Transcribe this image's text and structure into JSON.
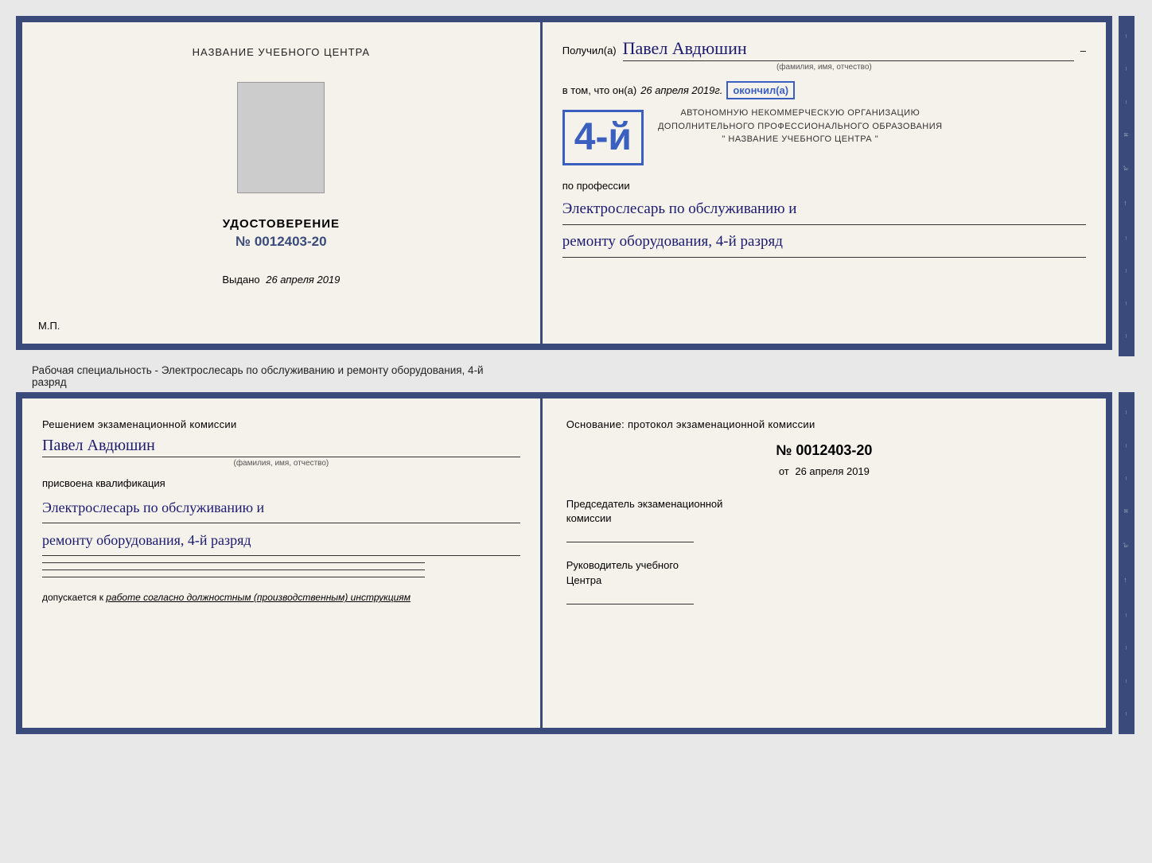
{
  "top_left": {
    "center_title": "НАЗВАНИЕ УЧЕБНОГО ЦЕНТРА",
    "udostoverenie_title": "УДОСТОВЕРЕНИЕ",
    "number": "№ 0012403-20",
    "vydano_label": "Выдано",
    "vydano_date": "26 апреля 2019",
    "mp": "М.П."
  },
  "top_right": {
    "poluchil_label": "Получил(а)",
    "poluchil_name": "Павел Авдюшин",
    "fio_subtitle": "(фамилия, имя, отчество)",
    "vtom_label": "в том, что он(a)",
    "vtom_date": "26 апреля 2019г.",
    "okonchil_label": "окончил(а)",
    "stamp_number": "4-й",
    "stamp_line1": "АВТОНОМНУЮ НЕКОММЕРЧЕСКУЮ ОРГАНИЗАЦИЮ",
    "stamp_line2": "ДОПОЛНИТЕЛЬНОГО ПРОФЕССИОНАЛЬНОГО ОБРАЗОВАНИЯ",
    "stamp_line3": "\" НАЗВАНИЕ УЧЕБНОГО ЦЕНТРА \"",
    "po_professii": "по профессии",
    "profession_line1": "Электрослесарь по обслуживанию и",
    "profession_line2": "ремонту оборудования, 4-й разряд"
  },
  "middle": {
    "text": "Рабочая специальность - Электрослесарь по обслуживанию и ремонту оборудования, 4-й"
  },
  "middle2": {
    "text": "разряд"
  },
  "bottom_left": {
    "resheniem_text": "Решением экзаменационной  комиссии",
    "name": "Павел Авдюшин",
    "fio_subtitle": "(фамилия, имя, отчество)",
    "prisvoena": "присвоена квалификация",
    "profession_line1": "Электрослесарь по обслуживанию и",
    "profession_line2": "ремонту оборудования, 4-й разряд",
    "dopuskaetsya_label": "допускается к",
    "dopuskaetsya_text": "работе согласно должностным (производственным) инструкциям"
  },
  "bottom_right": {
    "osnovanie_text": "Основание: протокол экзаменационной  комиссии",
    "number": "№  0012403-20",
    "ot_label": "от",
    "ot_date": "26 апреля 2019",
    "predsedatel_title": "Председатель экзаменационной",
    "predsedatel_subtitle": "комиссии",
    "rukovoditel_title": "Руководитель учебного",
    "rukovoditel_subtitle": "Центра"
  },
  "sidebar_chars": [
    "–",
    "–",
    "–",
    "и",
    ",а",
    "←",
    "–",
    "–",
    "–",
    "–"
  ]
}
